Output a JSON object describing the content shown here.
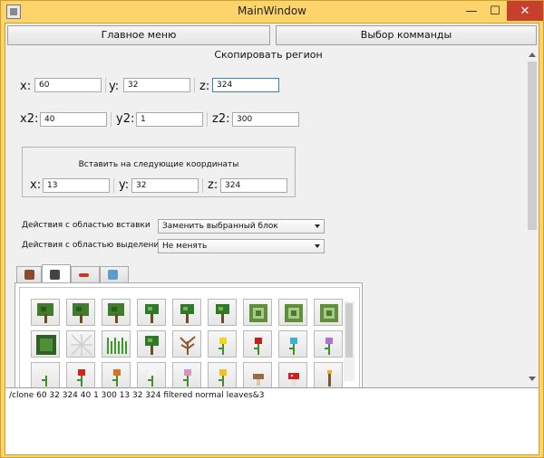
{
  "window": {
    "title": "MainWindow",
    "minimize": "—",
    "maximize": "☐",
    "close": "✕"
  },
  "menu": {
    "main_menu": "Главное меню",
    "command_select": "Выбор комманды"
  },
  "section_title": "Скопировать регион",
  "region": {
    "x": {
      "label": "x:",
      "value": "60"
    },
    "y": {
      "label": "y:",
      "value": "32"
    },
    "z": {
      "label": "z:",
      "value": "324"
    },
    "x2": {
      "label": "x2:",
      "value": "40"
    },
    "y2": {
      "label": "y2:",
      "value": "1"
    },
    "z2": {
      "label": "z2:",
      "value": "300"
    }
  },
  "paste": {
    "title": "Вставить на следующие координаты",
    "x": {
      "label": "x:",
      "value": "13"
    },
    "y": {
      "label": "y:",
      "value": "32"
    },
    "z": {
      "label": "z:",
      "value": "324"
    }
  },
  "options": {
    "insert_label": "Действия с областью вставки",
    "insert_value": "Заменить выбранный блок",
    "select_label": "Действия с областью выделения",
    "select_value": "Не менять"
  },
  "tabs": [
    {
      "icon": "brick-block-icon",
      "color": "#8b4a2f",
      "active": false
    },
    {
      "icon": "plant-tab-icon",
      "color": "#444444",
      "active": true
    },
    {
      "icon": "redstone-icon",
      "color": "#c0392b",
      "active": false
    },
    {
      "icon": "diamond-icon",
      "color": "#5a9ec9",
      "active": false
    }
  ],
  "item_icons": [
    "oak-leaves-icon",
    "spruce-leaves-icon",
    "birch-leaves-icon",
    "oak-sapling-icon",
    "birch-sapling-icon",
    "jungle-sapling-icon",
    "jungle-leaves-icon",
    "acacia-leaves-icon",
    "dark-oak-leaves-icon",
    "bush-block-icon",
    "cobweb-icon",
    "tall-grass-icon",
    "spruce-sapling-icon",
    "dead-bush-icon",
    "dandelion-icon",
    "poppy-icon",
    "blue-orchid-icon",
    "allium-icon",
    "oxeye-daisy-icon",
    "red-tulip-icon",
    "orange-tulip-icon",
    "white-tulip-icon",
    "pink-tulip-icon",
    "sunflower-icon",
    "brown-mushroom-icon",
    "red-mushroom-icon",
    "torch-icon"
  ],
  "output_text": "/clone 60 32 324 40 1 300 13 32 324 filtered normal leaves&3"
}
